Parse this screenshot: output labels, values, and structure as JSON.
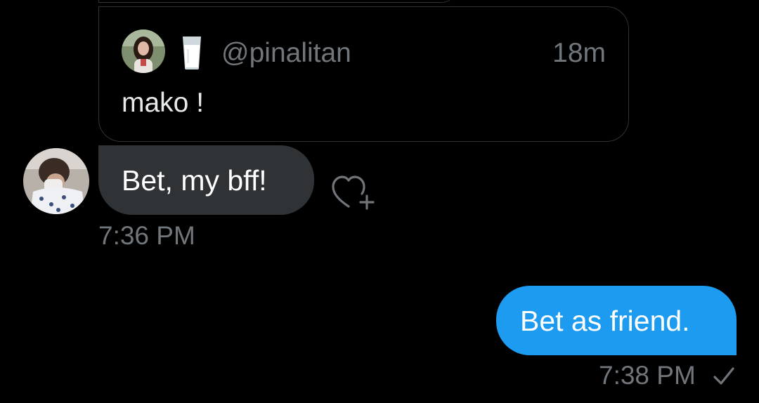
{
  "quoted_message": {
    "handle": "@pinalitan",
    "emoji_icon": "milk-glass-icon",
    "time": "18m",
    "text": "mako !"
  },
  "received_message": {
    "text": "Bet, my bff!",
    "time": "7:36 PM",
    "react_icon": "heart-plus-icon"
  },
  "sent_message": {
    "text": "Bet as friend.",
    "time": "7:38 PM",
    "status_icon": "check-icon"
  },
  "colors": {
    "background": "#000000",
    "received_bubble": "#2f3336",
    "sent_bubble": "#1d9bf0",
    "secondary_text": "#71767b",
    "border": "#2f3336"
  }
}
